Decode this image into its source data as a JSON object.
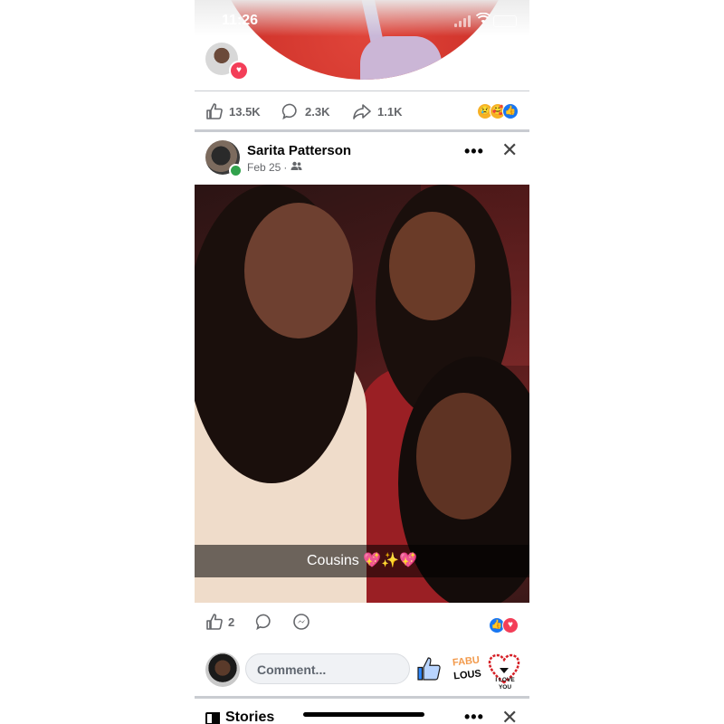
{
  "status_bar": {
    "time": "11:26"
  },
  "prev_post": {
    "likes": "13.5K",
    "comments": "2.3K",
    "shares": "1.1K"
  },
  "post": {
    "author": "Sarita Patterson",
    "date": "Feb 25",
    "audience_separator": "·",
    "audience_icon": "friends-icon",
    "caption": "Cousins 💖✨💖",
    "like_count": "2",
    "more_label": "•••",
    "close_label": "✕"
  },
  "comment": {
    "placeholder": "Comment..."
  },
  "stickers": {
    "fabulous_line1": "FABU",
    "fabulous_line2": "LOUS",
    "love": "I LOVE YOU"
  },
  "stories": {
    "title": "Stories"
  },
  "colors": {
    "facebook_blue": "#1877f2",
    "love_red": "#f33e58",
    "online_green": "#31a24c",
    "secondary_text": "#65676b"
  }
}
